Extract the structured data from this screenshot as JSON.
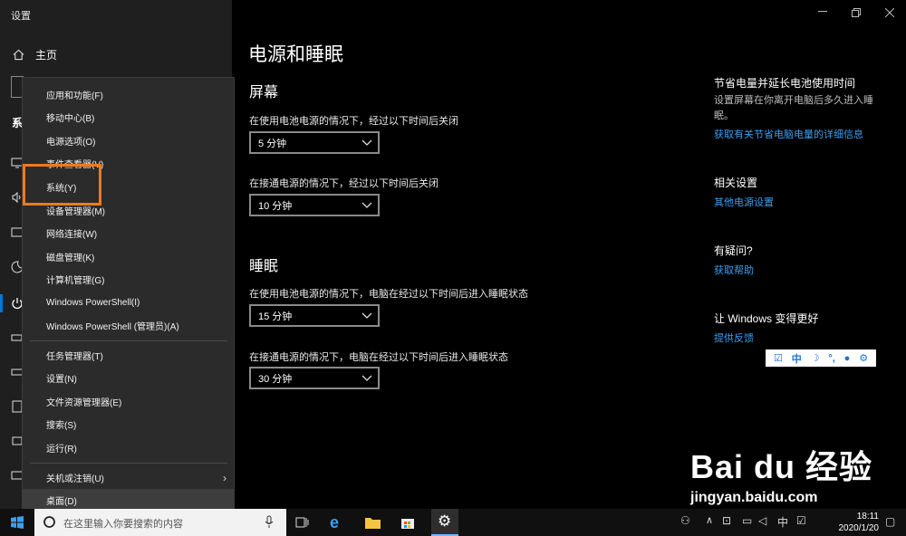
{
  "window": {
    "title": "设置"
  },
  "nav": {
    "home_label": "主页",
    "section_label": "系"
  },
  "context_menu": {
    "items": [
      "应用和功能(F)",
      "移动中心(B)",
      "电源选项(O)",
      "事件查看器(V)",
      "系统(Y)",
      "设备管理器(M)",
      "网络连接(W)",
      "磁盘管理(K)",
      "计算机管理(G)",
      "Windows PowerShell(I)",
      "Windows PowerShell (管理员)(A)",
      "任务管理器(T)",
      "设置(N)",
      "文件资源管理器(E)",
      "搜索(S)",
      "运行(R)",
      "关机或注销(U)",
      "桌面(D)"
    ]
  },
  "main": {
    "page_title": "电源和睡眠",
    "screen_section": "屏幕",
    "screen_battery_label": "在使用电池电源的情况下，经过以下时间后关闭",
    "screen_battery_value": "5 分钟",
    "screen_plugged_label": "在接通电源的情况下，经过以下时间后关闭",
    "screen_plugged_value": "10 分钟",
    "sleep_section": "睡眠",
    "sleep_battery_label": "在使用电池电源的情况下，电脑在经过以下时间后进入睡眠状态",
    "sleep_battery_value": "15 分钟",
    "sleep_plugged_label": "在接通电源的情况下，电脑在经过以下时间后进入睡眠状态",
    "sleep_plugged_value": "30 分钟"
  },
  "right_panel": {
    "save_title": "节省电量并延长电池使用时间",
    "save_text": "设置屏幕在你离开电脑后多久进入睡眠。",
    "save_link": "获取有关节省电脑电量的详细信息",
    "related_title": "相关设置",
    "related_link": "其他电源设置",
    "question_title": "有疑问?",
    "question_link": "获取帮助",
    "improve_title": "让 Windows 变得更好",
    "improve_link": "提供反馈"
  },
  "ime": {
    "mode": "中"
  },
  "taskbar": {
    "search_placeholder": "在这里输入你要搜索的内容",
    "time": "18:11",
    "date": "2020/1/20"
  },
  "watermark": {
    "brand": "Bai du 经验",
    "url": "jingyan.baidu.com"
  },
  "colors": {
    "accent": "#0078d7",
    "link": "#3a9ff0",
    "highlight": "#f07a1b"
  }
}
